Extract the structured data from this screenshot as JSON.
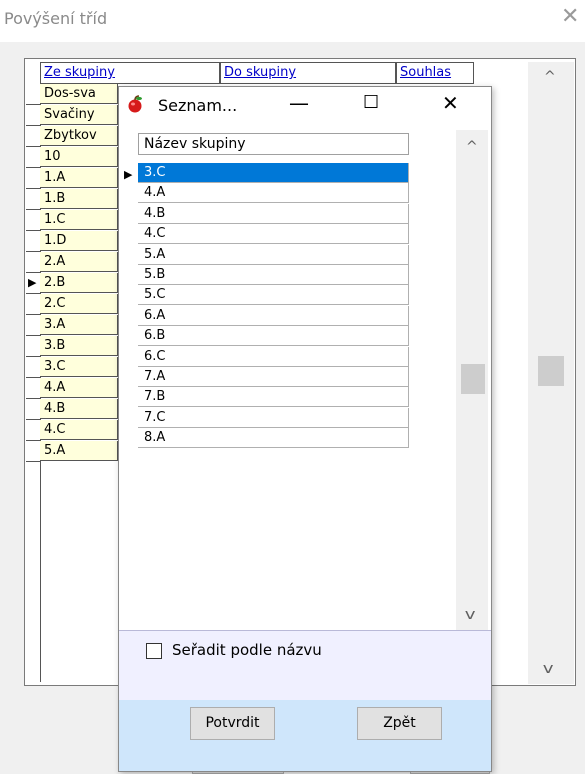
{
  "window": {
    "title": "Povýšení tříd",
    "close_glyph": "✕"
  },
  "background_grid": {
    "columns": [
      "Ze skupiny",
      "Do skupiny",
      "Souhlas"
    ],
    "rows": [
      "Dos-sva",
      "Svačiny",
      "Zbytkov",
      "10",
      "1.A",
      "1.B",
      "1.C",
      "1.D",
      "2.A",
      "2.B",
      "2.C",
      "3.A",
      "3.B",
      "3.C",
      "4.A",
      "4.B",
      "4.C",
      "5.A"
    ],
    "current_row": "2.B",
    "scroll_up": "^",
    "scroll_down": "v"
  },
  "dialog": {
    "title": "Seznam...",
    "icon": "apple-icon",
    "minimize_glyph": "—",
    "maximize_glyph": "☐",
    "close_glyph": "✕",
    "list_header": "Název skupiny",
    "items": [
      "3.C",
      "4.A",
      "4.B",
      "4.C",
      "5.A",
      "5.B",
      "5.C",
      "6.A",
      "6.B",
      "6.C",
      "7.A",
      "7.B",
      "7.C",
      "8.A"
    ],
    "selected_item": "3.C",
    "scroll_up": "^",
    "scroll_down": "v",
    "sort_checkbox_label": "Seřadit podle názvu",
    "sort_checked": false,
    "confirm_label": "Potvrdit",
    "back_label": "Zpět",
    "selection_color": "#0078d7",
    "footer_color": "#cfe6fb"
  }
}
